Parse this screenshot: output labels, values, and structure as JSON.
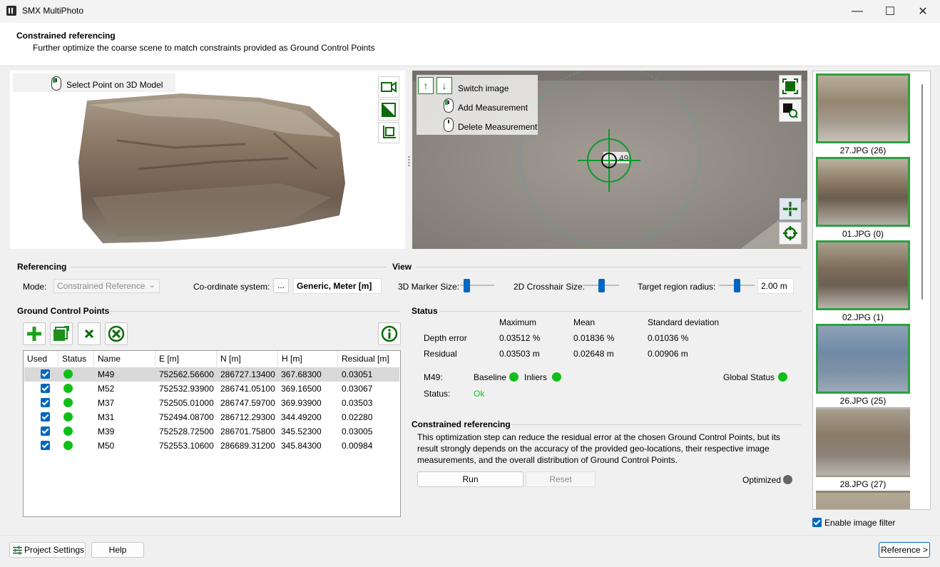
{
  "window": {
    "title": "SMX MultiPhoto",
    "minimize": "—",
    "maximize": "☐",
    "close": "✕"
  },
  "header": {
    "title": "Constrained referencing",
    "subtitle": "Further optimize the coarse scene to match constraints provided as Ground Control Points"
  },
  "viewer3d": {
    "hint": "Select Point on 3D Model"
  },
  "viewer2d": {
    "switch_image": "Switch image",
    "add_measurement": "Add Measurement",
    "delete_measurement": "Delete Measurement",
    "marker_label": "49"
  },
  "referencing": {
    "title": "Referencing",
    "mode_label": "Mode:",
    "mode_value": "Constrained Reference",
    "coord_label": "Co-ordinate system:",
    "coord_button": "...",
    "coord_value": "Generic, Meter [m]"
  },
  "view": {
    "title": "View",
    "marker_size_label": "3D Marker Size:",
    "crosshair_label": "2D Crosshair Size:",
    "target_radius_label": "Target region radius:",
    "target_radius_value": "2.00 m",
    "marker_size_level": 0.12,
    "crosshair_level": 0.5,
    "target_radius_level": 0.5
  },
  "gcp": {
    "title": "Ground Control Points",
    "columns": [
      "Used",
      "Status",
      "Name",
      "E [m]",
      "N [m]",
      "H [m]",
      "Residual [m]"
    ],
    "rows": [
      {
        "name": "M49",
        "e": "752562.56600",
        "n": "286727.13400",
        "h": "367.68300",
        "residual": "0.03051"
      },
      {
        "name": "M52",
        "e": "752532.93900",
        "n": "286741.05100",
        "h": "369.16500",
        "residual": "0.03067"
      },
      {
        "name": "M37",
        "e": "752505.01000",
        "n": "286747.59700",
        "h": "369.93900",
        "residual": "0.03503"
      },
      {
        "name": "M31",
        "e": "752494.08700",
        "n": "286712.29300",
        "h": "344.49200",
        "residual": "0.02280"
      },
      {
        "name": "M39",
        "e": "752528.72500",
        "n": "286701.75800",
        "h": "345.52300",
        "residual": "0.03005"
      },
      {
        "name": "M50",
        "e": "752553.10600",
        "n": "286689.31200",
        "h": "345.84300",
        "residual": "0.00984"
      }
    ]
  },
  "status": {
    "title": "Status",
    "col_max": "Maximum",
    "col_mean": "Mean",
    "col_std": "Standard deviation",
    "depth_label": "Depth error",
    "depth_max": "0.03512 %",
    "depth_mean": "0.01836 %",
    "depth_std": "0.01036 %",
    "residual_label": "Residual",
    "residual_max": "0.03503 m",
    "residual_mean": "0.02648 m",
    "residual_std": "0.00906 m",
    "point_label": "M49:",
    "baseline": "Baseline",
    "inliers": "Inliers",
    "global_status": "Global Status",
    "status_label": "Status:",
    "status_value": "Ok"
  },
  "constrained": {
    "title": "Constrained referencing",
    "desc1": "This optimization step can reduce the residual error at the chosen Ground Control Points, but its",
    "desc2": "result strongly depends on the accuracy of the provided geo-locations, their respective image",
    "desc3": "measurements, and the overall distribution of Ground Control Points.",
    "run": "Run",
    "reset": "Reset",
    "optimized": "Optimized"
  },
  "thumbnails": [
    "27.JPG (26)",
    "01.JPG (0)",
    "02.JPG (1)",
    "26.JPG (25)",
    "28.JPG (27)"
  ],
  "image_filter": "Enable image filter",
  "footer": {
    "project_settings": "Project Settings",
    "help": "Help",
    "next": "Reference >"
  },
  "colors": {
    "accent": "#0067c0",
    "status_green": "#0fbf17",
    "icon_green": "#2ea043",
    "optimized_gray": "#666666"
  }
}
